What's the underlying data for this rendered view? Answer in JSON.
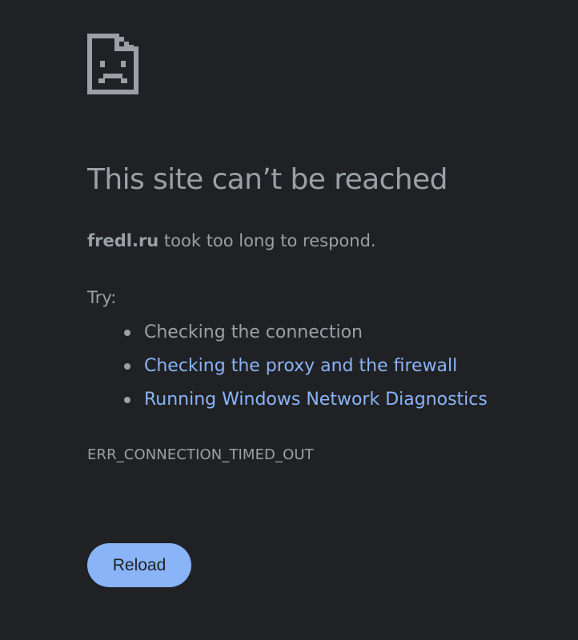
{
  "icon": "sad-page-icon",
  "title": "This site can’t be reached",
  "summary": {
    "host": "fredl.ru",
    "message": " took too long to respond."
  },
  "try_label": "Try:",
  "suggestions": [
    {
      "text": "Checking the connection",
      "link": false
    },
    {
      "text": "Checking the proxy and the firewall",
      "link": true
    },
    {
      "text": "Running Windows Network Diagnostics",
      "link": true
    }
  ],
  "error_code": "ERR_CONNECTION_TIMED_OUT",
  "reload_label": "Reload",
  "colors": {
    "background": "#202124",
    "text": "#9aa0a6",
    "link": "#8ab4f8",
    "button": "#8ab4f8"
  }
}
